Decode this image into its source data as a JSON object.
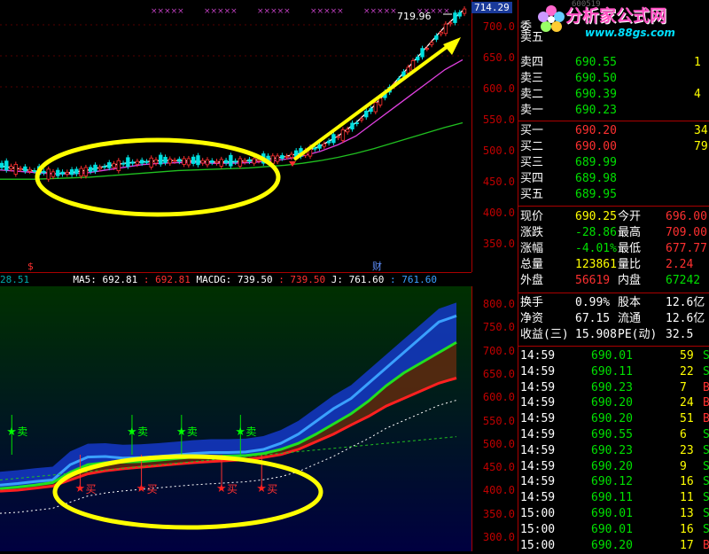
{
  "logo": {
    "name": "分析家公式网",
    "url": "www.88gs.com",
    "code_fragment": "600519"
  },
  "top_chart": {
    "axis_ticks": [
      "700.0",
      "650.0",
      "600.0",
      "550.0",
      "500.0",
      "450.0",
      "400.0",
      "350.0"
    ],
    "current_price_tag": "714.29",
    "peak_label": "719.96",
    "markers": [
      "$",
      "财"
    ]
  },
  "indicator_bar": {
    "first_value": "28.51",
    "ma5_label": "MA5: 692.81",
    "ma5_value": ": 692.81",
    "macdg_label": "MACDG: 739.50",
    "macdg_value": ": 739.50",
    "j_label": "J: 761.60",
    "j_value": ": 761.60"
  },
  "bottom_chart": {
    "axis_ticks": [
      "800.0",
      "750.0",
      "700.0",
      "650.0",
      "600.0",
      "550.0",
      "500.0",
      "450.0",
      "400.0",
      "350.0",
      "300.0"
    ],
    "sell_signal_label": "卖",
    "buy_signal_label": "买",
    "sell_signals_x": [
      0.025,
      0.28,
      0.385,
      0.51
    ],
    "buy_signals_x": [
      0.17,
      0.3,
      0.47,
      0.555
    ]
  },
  "quote": {
    "sell_rows": [
      {
        "label": "卖五",
        "price": "",
        "vol": ""
      },
      {
        "label": "卖四",
        "price": "690.55",
        "vol": "1"
      },
      {
        "label": "卖三",
        "price": "690.50",
        "vol": ""
      },
      {
        "label": "卖二",
        "price": "690.39",
        "vol": "4"
      },
      {
        "label": "卖一",
        "price": "690.23",
        "vol": ""
      }
    ],
    "buy_rows": [
      {
        "label": "买一",
        "price": "690.20",
        "vol": "34"
      },
      {
        "label": "买二",
        "price": "690.00",
        "vol": "79"
      },
      {
        "label": "买三",
        "price": "689.99",
        "vol": ""
      },
      {
        "label": "买四",
        "price": "689.98",
        "vol": ""
      },
      {
        "label": "买五",
        "price": "689.95",
        "vol": ""
      }
    ],
    "committee_label": "委",
    "stats": [
      {
        "l1": "现价",
        "v1": "690.25",
        "l2": "今开",
        "v2": "696.00"
      },
      {
        "l1": "涨跌",
        "v1": "-28.86",
        "l2": "最高",
        "v2": "709.00"
      },
      {
        "l1": "涨幅",
        "v1": "-4.01%",
        "l2": "最低",
        "v2": "677.77"
      },
      {
        "l1": "总量",
        "v1": "123861",
        "l2": "量比",
        "v2": "2.24"
      },
      {
        "l1": "外盘",
        "v1": "56619",
        "l2": "内盘",
        "v2": "67242"
      }
    ],
    "stats2": [
      {
        "l1": "换手",
        "v1": "0.99%",
        "l2": "股本",
        "v2": "12.6亿"
      },
      {
        "l1": "净资",
        "v1": "67.15",
        "l2": "流通",
        "v2": "12.6亿"
      },
      {
        "l1": "收益(三)",
        "v1": "15.908",
        "l2": "PE(动)",
        "v2": "32.5"
      }
    ],
    "ticks": [
      {
        "t": "14:59",
        "p": "690.01",
        "v": "59",
        "f": "S"
      },
      {
        "t": "14:59",
        "p": "690.11",
        "v": "22",
        "f": "S"
      },
      {
        "t": "14:59",
        "p": "690.23",
        "v": "7",
        "f": "B"
      },
      {
        "t": "14:59",
        "p": "690.20",
        "v": "24",
        "f": "B"
      },
      {
        "t": "14:59",
        "p": "690.20",
        "v": "51",
        "f": "B"
      },
      {
        "t": "14:59",
        "p": "690.55",
        "v": "6",
        "f": "S"
      },
      {
        "t": "14:59",
        "p": "690.23",
        "v": "23",
        "f": "S"
      },
      {
        "t": "14:59",
        "p": "690.20",
        "v": "9",
        "f": "S"
      },
      {
        "t": "14:59",
        "p": "690.12",
        "v": "16",
        "f": "S"
      },
      {
        "t": "14:59",
        "p": "690.11",
        "v": "11",
        "f": "S"
      },
      {
        "t": "15:00",
        "p": "690.01",
        "v": "13",
        "f": "S"
      },
      {
        "t": "15:00",
        "p": "690.01",
        "v": "16",
        "f": "S"
      },
      {
        "t": "15:00",
        "p": "690.20",
        "v": "17",
        "f": "B"
      }
    ]
  },
  "colors": {
    "up": "#ff3030",
    "down": "#00e000",
    "ma_white": "#ffffff",
    "ma_magenta": "#e040e0",
    "ma_green": "#20c020",
    "annotation": "#ffff00",
    "grid": "#a00000"
  },
  "chart_data": [
    {
      "type": "line",
      "title": "",
      "ylim": [
        320,
        730
      ],
      "series": [
        {
          "values": [
            480,
            476,
            472,
            468,
            470,
            474,
            480,
            484,
            486,
            488,
            488,
            487,
            486,
            486,
            488,
            490,
            494,
            500,
            510,
            525,
            545,
            570,
            600,
            630,
            660,
            690,
            714
          ]
        },
        {
          "values": [
            474,
            472,
            470,
            468,
            468,
            470,
            474,
            478,
            482,
            484,
            485,
            485,
            484,
            484,
            485,
            487,
            490,
            495,
            502,
            512,
            525,
            545,
            565,
            585,
            605,
            625,
            640
          ]
        },
        {
          "values": [
            460,
            460,
            460,
            461,
            462,
            463,
            465,
            467,
            469,
            471,
            473,
            474,
            475,
            476,
            477,
            479,
            481,
            484,
            488,
            493,
            499,
            506,
            514,
            522,
            530,
            538,
            545
          ]
        }
      ],
      "peak": 719.96
    },
    {
      "type": "area",
      "title": "",
      "ylim": [
        300,
        820
      ],
      "series": [
        {
          "values": [
            430,
            433,
            437,
            440,
            470,
            485,
            486,
            483,
            484,
            486,
            489,
            492,
            494,
            494,
            495,
            500,
            512,
            530,
            555,
            580,
            600,
            630,
            660,
            690,
            720,
            750,
            762
          ]
        },
        {
          "values": [
            423,
            426,
            430,
            435,
            455,
            470,
            474,
            475,
            476,
            479,
            482,
            485,
            486,
            487,
            488,
            492,
            500,
            512,
            530,
            550,
            570,
            595,
            625,
            650,
            670,
            690,
            710
          ]
        },
        {
          "values": [
            418,
            420,
            424,
            428,
            440,
            452,
            458,
            462,
            465,
            468,
            471,
            474,
            476,
            478,
            480,
            484,
            490,
            500,
            515,
            530,
            548,
            565,
            585,
            600,
            615,
            630,
            640
          ]
        }
      ]
    }
  ]
}
